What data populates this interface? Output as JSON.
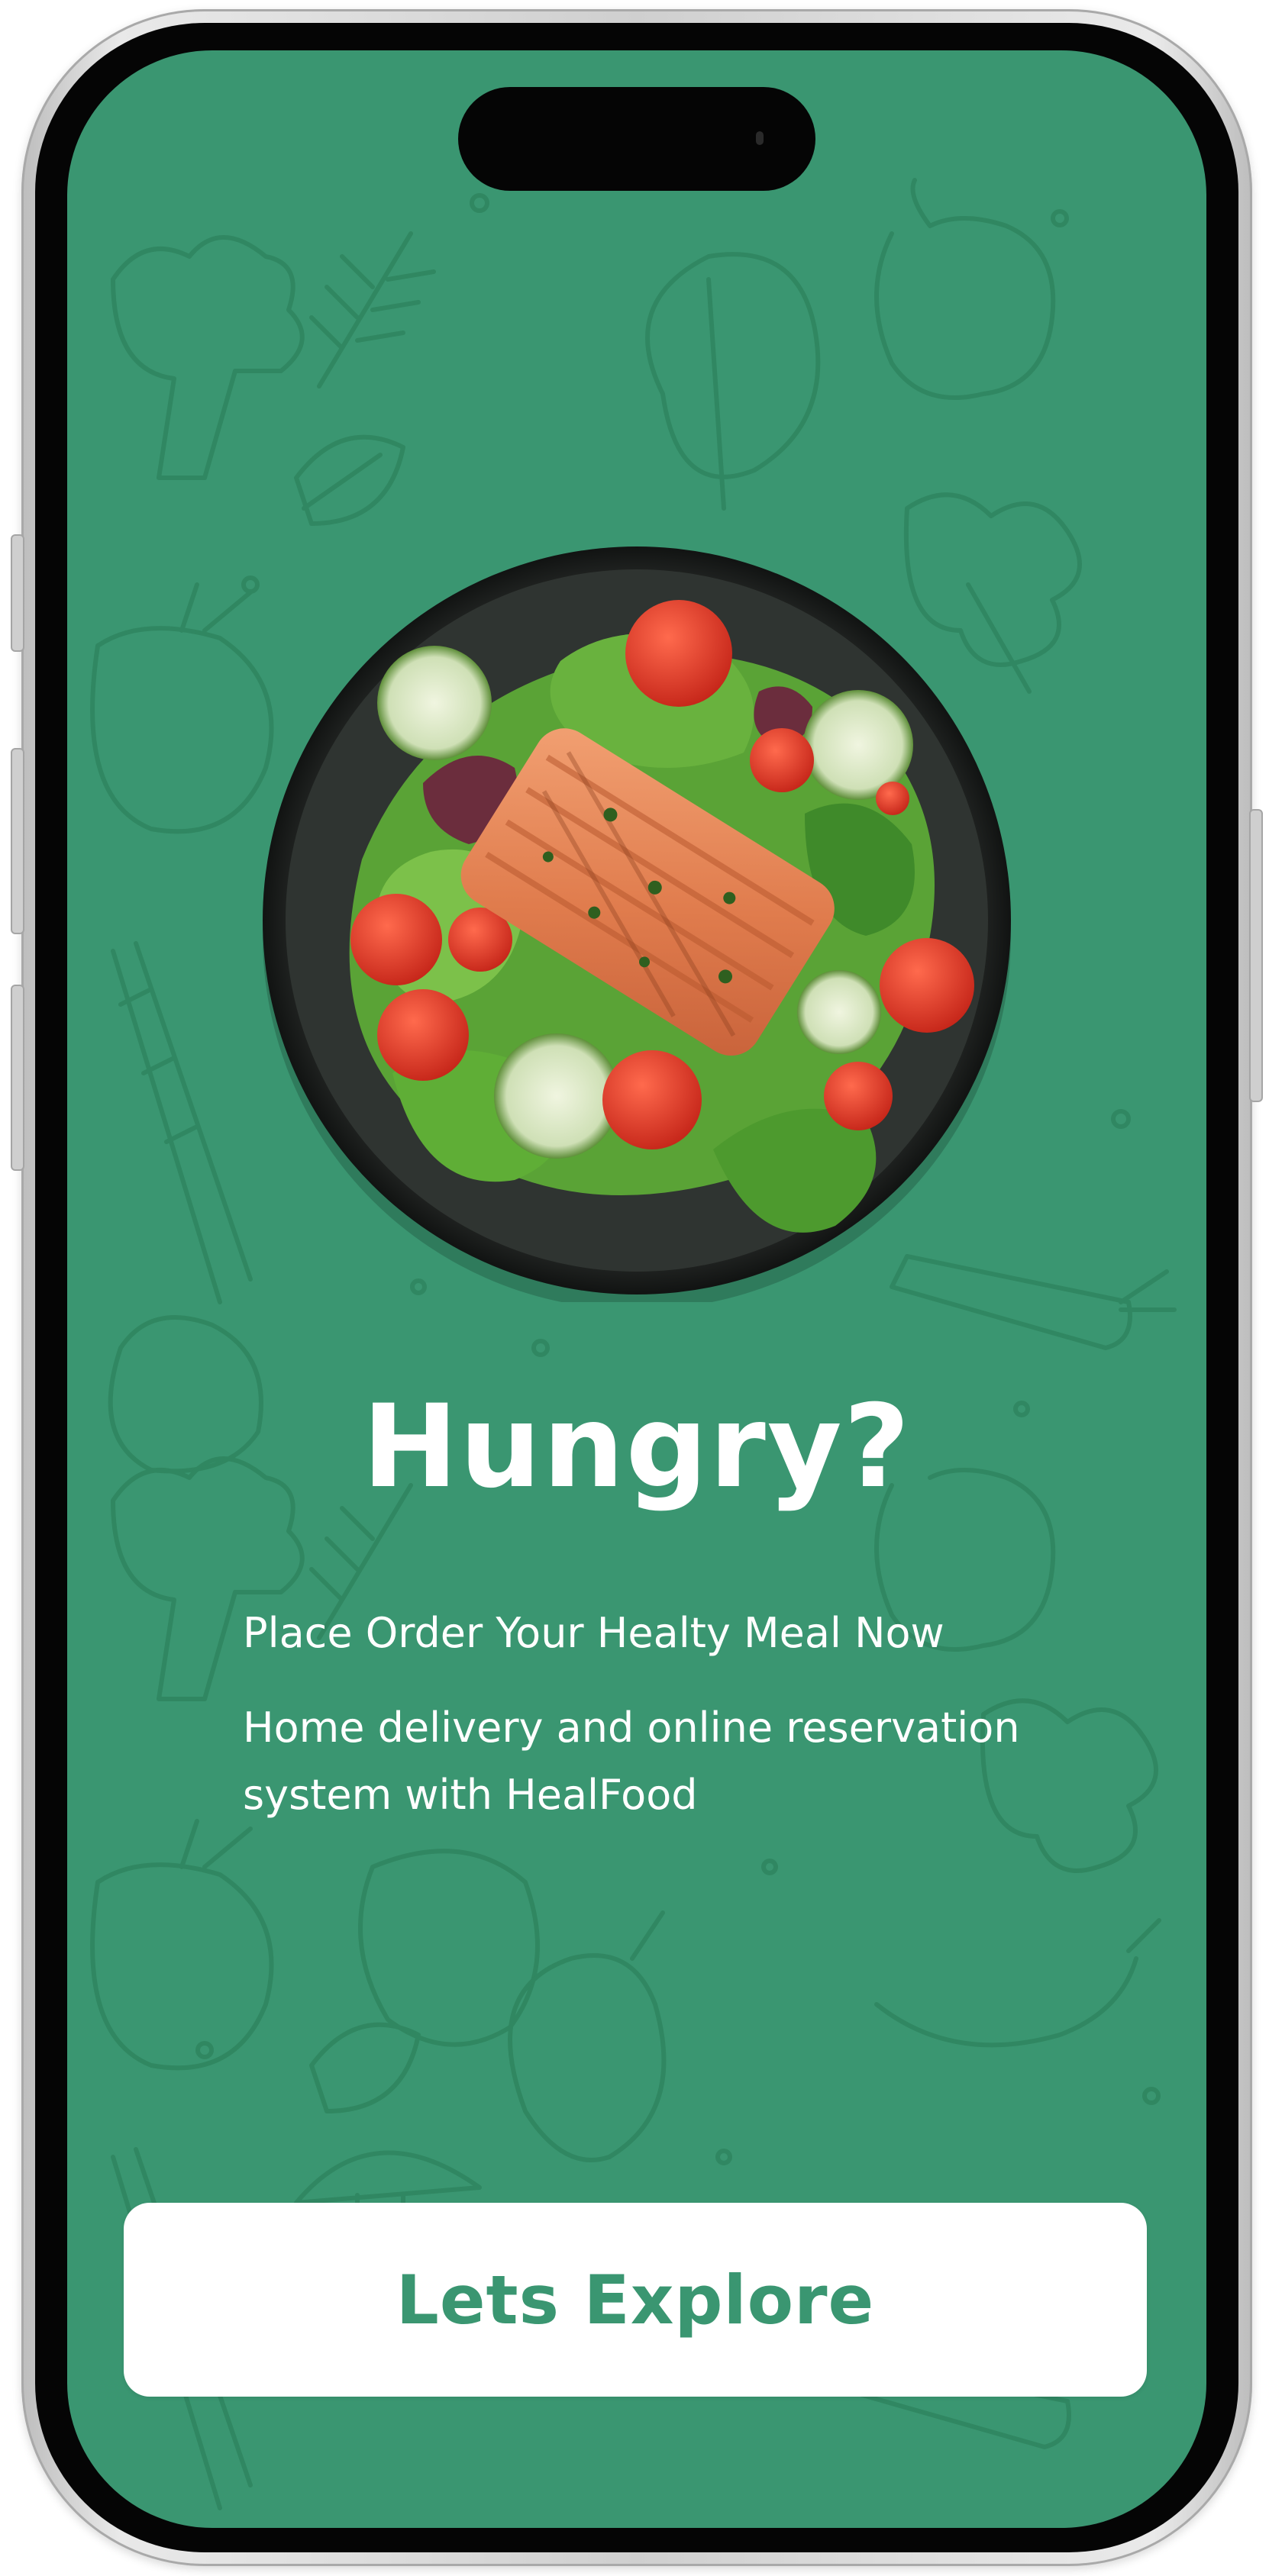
{
  "colors": {
    "background": "#3a9671",
    "pattern_stroke": "#2f855f",
    "text": "#ffffff",
    "button_background": "#ffffff",
    "button_text": "#3a9671"
  },
  "hero": {
    "image": "salmon-salad-bowl",
    "title": "Hungry?"
  },
  "content": {
    "subtitle": "Place Order Your Healty Meal Now",
    "description": "Home delivery and online reservation system with HealFood"
  },
  "actions": {
    "explore_label": "Lets Explore"
  }
}
